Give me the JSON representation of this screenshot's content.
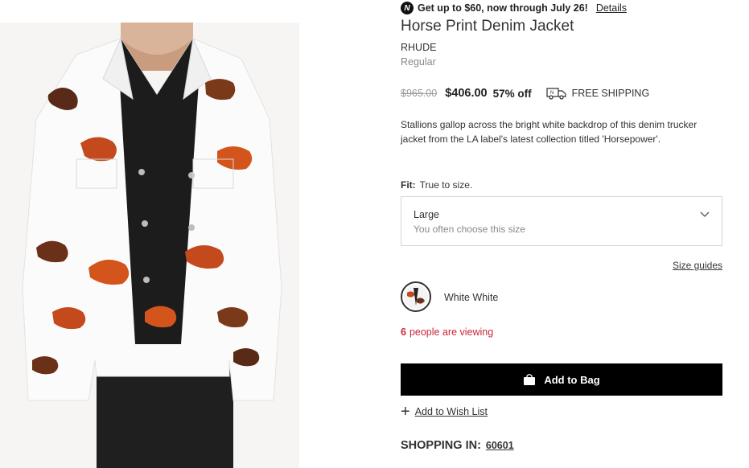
{
  "promo": {
    "badge": "N",
    "text": "Get up to $60, now through July 26!",
    "link": "Details"
  },
  "product": {
    "title": "Horse Print Denim Jacket",
    "brand": "RHUDE",
    "fit_type": "Regular",
    "original_price": "$965.00",
    "sale_price": "$406.00",
    "discount": "57% off",
    "shipping": "FREE SHIPPING",
    "description": "Stallions gallop across the bright white backdrop of this denim trucker jacket from the LA label's latest collection titled 'Horsepower'."
  },
  "fit": {
    "label": "Fit:",
    "value": "True to size."
  },
  "size_select": {
    "value": "Large",
    "hint": "You often choose this size"
  },
  "size_guides": "Size guides",
  "color": {
    "label": "White White"
  },
  "viewing": {
    "count": "6",
    "text": "people are viewing"
  },
  "add_to_bag": "Add to Bag",
  "wish_list": "Add to Wish List",
  "shopping": {
    "label": "SHOPPING IN:",
    "zip": "60601"
  },
  "colors": {
    "sale_accent": "#c8283a",
    "button_bg": "#000000"
  },
  "icons": [
    "nordy-badge-icon",
    "truck-icon",
    "chevron-down-icon",
    "shopping-bag-icon",
    "plus-icon"
  ]
}
